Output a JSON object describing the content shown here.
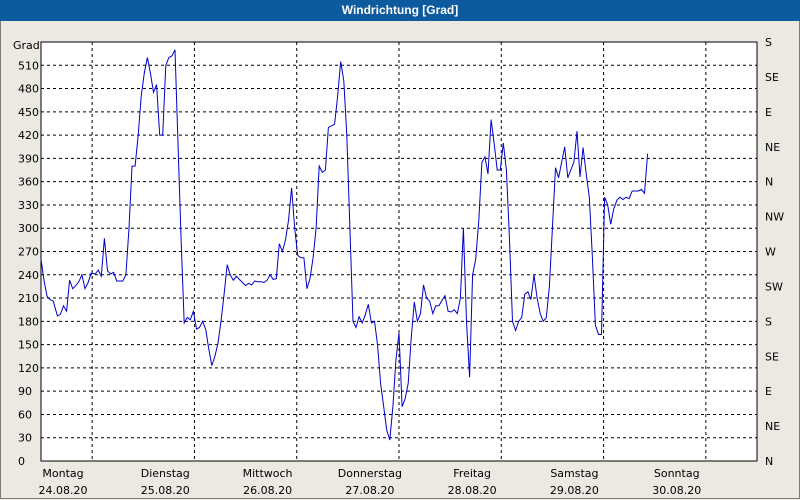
{
  "window": {
    "title": "Windrichtung [Grad]"
  },
  "chart_data": {
    "type": "line",
    "title": "Windrichtung [Grad]",
    "ylabel": "Grad",
    "ylim": [
      0,
      540
    ],
    "y_ticks": [
      0,
      30,
      60,
      90,
      120,
      150,
      180,
      210,
      240,
      270,
      300,
      330,
      360,
      390,
      420,
      450,
      480,
      510
    ],
    "right_axis_labels": [
      "N",
      "NE",
      "E",
      "SE",
      "S",
      "SW",
      "W",
      "NW",
      "N",
      "NE",
      "E",
      "SE",
      "S"
    ],
    "grid": true,
    "x_ticks": [
      {
        "day": "Montag",
        "date": "24.08.20"
      },
      {
        "day": "Dienstag",
        "date": "25.08.20"
      },
      {
        "day": "Mittwoch",
        "date": "26.08.20"
      },
      {
        "day": "Donnerstag",
        "date": "27.08.20"
      },
      {
        "day": "Freitag",
        "date": "28.08.20"
      },
      {
        "day": "Samstag",
        "date": "29.08.20"
      },
      {
        "day": "Sonntag",
        "date": "30.08.20"
      }
    ],
    "x_unit": "days since Montag 24.08.20 00:00",
    "xlim": [
      0,
      7.0
    ],
    "series": [
      {
        "color": "#0000cc",
        "points": [
          [
            0.0,
            260
          ],
          [
            0.03,
            232
          ],
          [
            0.06,
            212
          ],
          [
            0.09,
            208
          ],
          [
            0.12,
            206
          ],
          [
            0.16,
            187
          ],
          [
            0.19,
            189
          ],
          [
            0.22,
            200
          ],
          [
            0.25,
            193
          ],
          [
            0.28,
            233
          ],
          [
            0.31,
            222
          ],
          [
            0.34,
            226
          ],
          [
            0.37,
            231
          ],
          [
            0.4,
            240
          ],
          [
            0.43,
            222
          ],
          [
            0.46,
            230
          ],
          [
            0.49,
            242
          ],
          [
            0.53,
            241
          ],
          [
            0.56,
            246
          ],
          [
            0.59,
            238
          ],
          [
            0.62,
            287
          ],
          [
            0.65,
            245
          ],
          [
            0.68,
            241
          ],
          [
            0.71,
            243
          ],
          [
            0.74,
            232
          ],
          [
            0.77,
            232
          ],
          [
            0.8,
            232
          ],
          [
            0.83,
            240
          ],
          [
            0.86,
            300
          ],
          [
            0.89,
            380
          ],
          [
            0.92,
            380
          ],
          [
            0.95,
            420
          ],
          [
            0.98,
            470
          ],
          [
            1.01,
            500
          ],
          [
            1.04,
            520
          ],
          [
            1.07,
            500
          ],
          [
            1.1,
            475
          ],
          [
            1.13,
            485
          ],
          [
            1.16,
            420
          ],
          [
            1.19,
            420
          ],
          [
            1.22,
            510
          ],
          [
            1.25,
            520
          ],
          [
            1.28,
            522
          ],
          [
            1.31,
            530
          ],
          [
            1.34,
            405
          ],
          [
            1.37,
            285
          ],
          [
            1.4,
            178
          ],
          [
            1.43,
            185
          ],
          [
            1.46,
            182
          ],
          [
            1.49,
            193
          ],
          [
            1.52,
            170
          ],
          [
            1.55,
            172
          ],
          [
            1.58,
            180
          ],
          [
            1.61,
            170
          ],
          [
            1.64,
            145
          ],
          [
            1.67,
            123
          ],
          [
            1.7,
            135
          ],
          [
            1.73,
            152
          ],
          [
            1.76,
            180
          ],
          [
            1.79,
            215
          ],
          [
            1.82,
            253
          ],
          [
            1.85,
            240
          ],
          [
            1.88,
            233
          ],
          [
            1.91,
            238
          ],
          [
            1.94,
            234
          ],
          [
            1.97,
            230
          ],
          [
            2.0,
            226
          ],
          [
            2.03,
            229
          ],
          [
            2.06,
            227
          ],
          [
            2.09,
            232
          ],
          [
            2.12,
            231
          ],
          [
            2.15,
            231
          ],
          [
            2.18,
            230
          ],
          [
            2.21,
            233
          ],
          [
            2.24,
            240
          ],
          [
            2.27,
            234
          ],
          [
            2.3,
            235
          ],
          [
            2.33,
            280
          ],
          [
            2.36,
            270
          ],
          [
            2.39,
            285
          ],
          [
            2.42,
            310
          ],
          [
            2.45,
            352
          ],
          [
            2.48,
            300
          ],
          [
            2.51,
            265
          ],
          [
            2.54,
            262
          ],
          [
            2.57,
            262
          ],
          [
            2.6,
            222
          ],
          [
            2.63,
            235
          ],
          [
            2.66,
            262
          ],
          [
            2.69,
            300
          ],
          [
            2.72,
            380
          ],
          [
            2.75,
            372
          ],
          [
            2.78,
            375
          ],
          [
            2.81,
            430
          ],
          [
            2.84,
            432
          ],
          [
            2.87,
            434
          ],
          [
            2.9,
            470
          ],
          [
            2.93,
            515
          ],
          [
            2.96,
            490
          ],
          [
            2.99,
            420
          ],
          [
            3.02,
            300
          ],
          [
            3.05,
            180
          ],
          [
            3.08,
            172
          ],
          [
            3.11,
            186
          ],
          [
            3.14,
            178
          ],
          [
            3.17,
            188
          ],
          [
            3.2,
            202
          ],
          [
            3.23,
            178
          ],
          [
            3.26,
            180
          ],
          [
            3.29,
            150
          ],
          [
            3.32,
            100
          ],
          [
            3.35,
            70
          ],
          [
            3.38,
            40
          ],
          [
            3.41,
            27
          ],
          [
            3.44,
            70
          ],
          [
            3.47,
            130
          ],
          [
            3.5,
            165
          ],
          [
            3.53,
            70
          ],
          [
            3.56,
            80
          ],
          [
            3.59,
            100
          ],
          [
            3.62,
            160
          ],
          [
            3.65,
            205
          ],
          [
            3.68,
            180
          ],
          [
            3.71,
            190
          ],
          [
            3.74,
            227
          ],
          [
            3.77,
            210
          ],
          [
            3.8,
            206
          ],
          [
            3.83,
            190
          ],
          [
            3.86,
            200
          ],
          [
            3.89,
            200
          ],
          [
            3.92,
            207
          ],
          [
            3.95,
            213
          ],
          [
            3.98,
            193
          ],
          [
            4.01,
            192
          ],
          [
            4.04,
            195
          ],
          [
            4.07,
            190
          ],
          [
            4.1,
            210
          ],
          [
            4.13,
            300
          ],
          [
            4.16,
            180
          ],
          [
            4.19,
            108
          ],
          [
            4.22,
            240
          ],
          [
            4.25,
            260
          ],
          [
            4.28,
            310
          ],
          [
            4.31,
            385
          ],
          [
            4.34,
            392
          ],
          [
            4.37,
            370
          ],
          [
            4.4,
            440
          ],
          [
            4.43,
            410
          ],
          [
            4.46,
            375
          ],
          [
            4.49,
            375
          ],
          [
            4.52,
            410
          ],
          [
            4.55,
            375
          ],
          [
            4.58,
            285
          ],
          [
            4.61,
            180
          ],
          [
            4.64,
            168
          ],
          [
            4.67,
            180
          ],
          [
            4.7,
            185
          ],
          [
            4.73,
            215
          ],
          [
            4.76,
            218
          ],
          [
            4.79,
            208
          ],
          [
            4.82,
            240
          ],
          [
            4.85,
            210
          ],
          [
            4.88,
            190
          ],
          [
            4.91,
            180
          ],
          [
            4.94,
            185
          ],
          [
            4.97,
            225
          ],
          [
            5.0,
            300
          ],
          [
            5.03,
            378
          ],
          [
            5.06,
            365
          ],
          [
            5.09,
            385
          ],
          [
            5.12,
            405
          ],
          [
            5.15,
            365
          ],
          [
            5.18,
            375
          ],
          [
            5.21,
            385
          ],
          [
            5.24,
            425
          ],
          [
            5.27,
            366
          ],
          [
            5.3,
            404
          ],
          [
            5.33,
            370
          ],
          [
            5.36,
            340
          ],
          [
            5.39,
            265
          ],
          [
            5.42,
            175
          ],
          [
            5.45,
            163
          ],
          [
            5.48,
            163
          ],
          [
            5.51,
            340
          ],
          [
            5.54,
            330
          ],
          [
            5.57,
            305
          ],
          [
            5.6,
            325
          ],
          [
            5.63,
            336
          ],
          [
            5.66,
            340
          ],
          [
            5.69,
            337
          ],
          [
            5.72,
            340
          ],
          [
            5.75,
            338
          ],
          [
            5.78,
            348
          ],
          [
            5.81,
            348
          ],
          [
            5.84,
            348
          ],
          [
            5.87,
            350
          ],
          [
            5.9,
            345
          ],
          [
            5.93,
            396
          ]
        ]
      }
    ]
  }
}
